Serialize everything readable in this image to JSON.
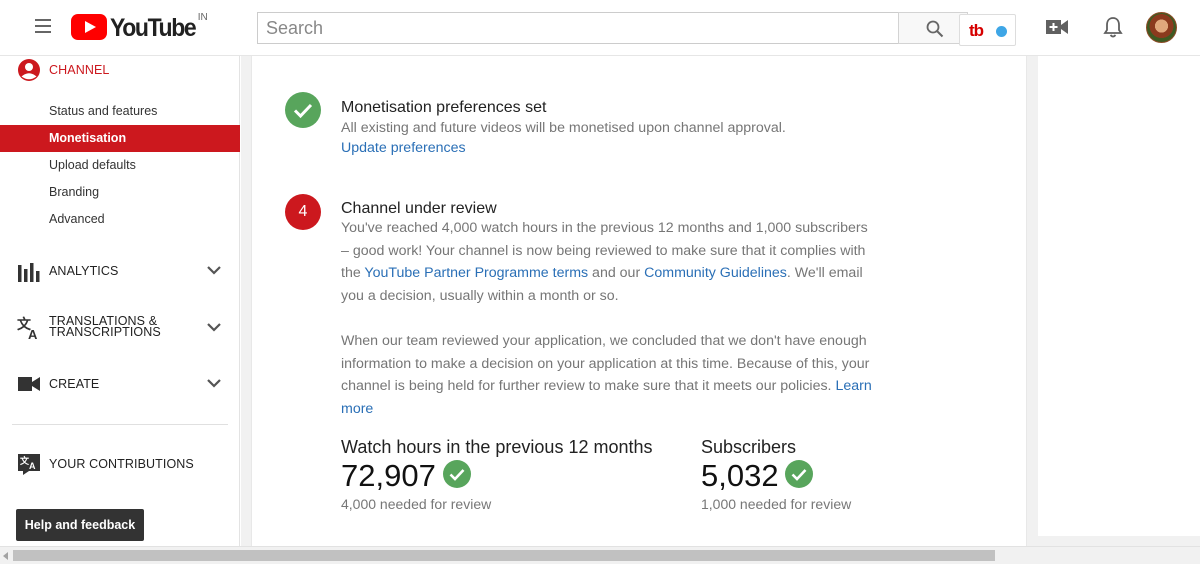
{
  "header": {
    "logo_text": "YouTube",
    "logo_country": "IN",
    "search_placeholder": "Search",
    "tubebuddy_label": "tb"
  },
  "sidebar": {
    "channel_label": "CHANNEL",
    "channel_items": [
      {
        "label": "Status and features",
        "active": false
      },
      {
        "label": "Monetisation",
        "active": true
      },
      {
        "label": "Upload defaults",
        "active": false
      },
      {
        "label": "Branding",
        "active": false
      },
      {
        "label": "Advanced",
        "active": false
      }
    ],
    "analytics_label": "ANALYTICS",
    "translations_label_1": "TRANSLATIONS &",
    "translations_label_2": "TRANSCRIPTIONS",
    "create_label": "CREATE",
    "contributions_label": "YOUR CONTRIBUTIONS",
    "help_label": "Help and feedback"
  },
  "main": {
    "step3": {
      "title": "Monetisation preferences set",
      "body": "All existing and future videos will be monetised upon channel approval.",
      "link": "Update preferences"
    },
    "step4": {
      "number": "4",
      "title": "Channel under review",
      "p1_a": "You've reached 4,000 watch hours in the previous 12 months and 1,000 subscribers – good work! Your channel is now being reviewed to make sure that it complies with the ",
      "p1_link1": "YouTube Partner Programme terms",
      "p1_b": " and our ",
      "p1_link2": "Community Guidelines",
      "p1_c": ". We'll email you a decision, usually within a month or so.",
      "p2_a": "When our team reviewed your application, we concluded that we don't have enough information to make a decision on your application at this time. Because of this, your channel is being held for further review to make sure that it meets our policies. ",
      "p2_link": "Learn more"
    },
    "stats": {
      "watch_label": "Watch hours in the previous 12 months",
      "watch_value": "72,907",
      "watch_note": "4,000 needed for review",
      "subs_label": "Subscribers",
      "subs_value": "5,032",
      "subs_note": "1,000 needed for review"
    }
  },
  "colors": {
    "brand_red": "#cc181e",
    "success_green": "#58a55c",
    "link_blue": "#2a6fb6"
  }
}
